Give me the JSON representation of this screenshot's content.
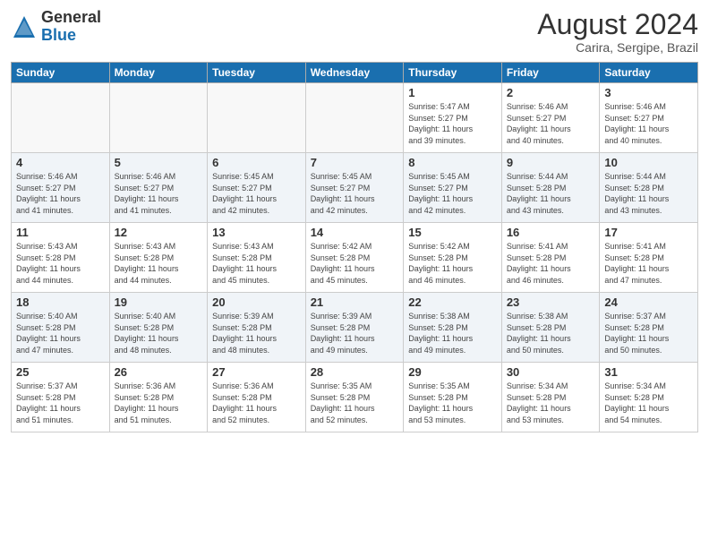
{
  "header": {
    "logo_general": "General",
    "logo_blue": "Blue",
    "month_year": "August 2024",
    "location": "Carira, Sergipe, Brazil"
  },
  "days_of_week": [
    "Sunday",
    "Monday",
    "Tuesday",
    "Wednesday",
    "Thursday",
    "Friday",
    "Saturday"
  ],
  "weeks": [
    [
      {
        "day": "",
        "sunrise": "",
        "sunset": "",
        "daylight": ""
      },
      {
        "day": "",
        "sunrise": "",
        "sunset": "",
        "daylight": ""
      },
      {
        "day": "",
        "sunrise": "",
        "sunset": "",
        "daylight": ""
      },
      {
        "day": "",
        "sunrise": "",
        "sunset": "",
        "daylight": ""
      },
      {
        "day": "1",
        "sunrise": "5:47 AM",
        "sunset": "5:27 PM",
        "daylight": "11 hours and 39 minutes."
      },
      {
        "day": "2",
        "sunrise": "5:46 AM",
        "sunset": "5:27 PM",
        "daylight": "11 hours and 40 minutes."
      },
      {
        "day": "3",
        "sunrise": "5:46 AM",
        "sunset": "5:27 PM",
        "daylight": "11 hours and 40 minutes."
      }
    ],
    [
      {
        "day": "4",
        "sunrise": "5:46 AM",
        "sunset": "5:27 PM",
        "daylight": "11 hours and 41 minutes."
      },
      {
        "day": "5",
        "sunrise": "5:46 AM",
        "sunset": "5:27 PM",
        "daylight": "11 hours and 41 minutes."
      },
      {
        "day": "6",
        "sunrise": "5:45 AM",
        "sunset": "5:27 PM",
        "daylight": "11 hours and 42 minutes."
      },
      {
        "day": "7",
        "sunrise": "5:45 AM",
        "sunset": "5:27 PM",
        "daylight": "11 hours and 42 minutes."
      },
      {
        "day": "8",
        "sunrise": "5:45 AM",
        "sunset": "5:27 PM",
        "daylight": "11 hours and 42 minutes."
      },
      {
        "day": "9",
        "sunrise": "5:44 AM",
        "sunset": "5:28 PM",
        "daylight": "11 hours and 43 minutes."
      },
      {
        "day": "10",
        "sunrise": "5:44 AM",
        "sunset": "5:28 PM",
        "daylight": "11 hours and 43 minutes."
      }
    ],
    [
      {
        "day": "11",
        "sunrise": "5:43 AM",
        "sunset": "5:28 PM",
        "daylight": "11 hours and 44 minutes."
      },
      {
        "day": "12",
        "sunrise": "5:43 AM",
        "sunset": "5:28 PM",
        "daylight": "11 hours and 44 minutes."
      },
      {
        "day": "13",
        "sunrise": "5:43 AM",
        "sunset": "5:28 PM",
        "daylight": "11 hours and 45 minutes."
      },
      {
        "day": "14",
        "sunrise": "5:42 AM",
        "sunset": "5:28 PM",
        "daylight": "11 hours and 45 minutes."
      },
      {
        "day": "15",
        "sunrise": "5:42 AM",
        "sunset": "5:28 PM",
        "daylight": "11 hours and 46 minutes."
      },
      {
        "day": "16",
        "sunrise": "5:41 AM",
        "sunset": "5:28 PM",
        "daylight": "11 hours and 46 minutes."
      },
      {
        "day": "17",
        "sunrise": "5:41 AM",
        "sunset": "5:28 PM",
        "daylight": "11 hours and 47 minutes."
      }
    ],
    [
      {
        "day": "18",
        "sunrise": "5:40 AM",
        "sunset": "5:28 PM",
        "daylight": "11 hours and 47 minutes."
      },
      {
        "day": "19",
        "sunrise": "5:40 AM",
        "sunset": "5:28 PM",
        "daylight": "11 hours and 48 minutes."
      },
      {
        "day": "20",
        "sunrise": "5:39 AM",
        "sunset": "5:28 PM",
        "daylight": "11 hours and 48 minutes."
      },
      {
        "day": "21",
        "sunrise": "5:39 AM",
        "sunset": "5:28 PM",
        "daylight": "11 hours and 49 minutes."
      },
      {
        "day": "22",
        "sunrise": "5:38 AM",
        "sunset": "5:28 PM",
        "daylight": "11 hours and 49 minutes."
      },
      {
        "day": "23",
        "sunrise": "5:38 AM",
        "sunset": "5:28 PM",
        "daylight": "11 hours and 50 minutes."
      },
      {
        "day": "24",
        "sunrise": "5:37 AM",
        "sunset": "5:28 PM",
        "daylight": "11 hours and 50 minutes."
      }
    ],
    [
      {
        "day": "25",
        "sunrise": "5:37 AM",
        "sunset": "5:28 PM",
        "daylight": "11 hours and 51 minutes."
      },
      {
        "day": "26",
        "sunrise": "5:36 AM",
        "sunset": "5:28 PM",
        "daylight": "11 hours and 51 minutes."
      },
      {
        "day": "27",
        "sunrise": "5:36 AM",
        "sunset": "5:28 PM",
        "daylight": "11 hours and 52 minutes."
      },
      {
        "day": "28",
        "sunrise": "5:35 AM",
        "sunset": "5:28 PM",
        "daylight": "11 hours and 52 minutes."
      },
      {
        "day": "29",
        "sunrise": "5:35 AM",
        "sunset": "5:28 PM",
        "daylight": "11 hours and 53 minutes."
      },
      {
        "day": "30",
        "sunrise": "5:34 AM",
        "sunset": "5:28 PM",
        "daylight": "11 hours and 53 minutes."
      },
      {
        "day": "31",
        "sunrise": "5:34 AM",
        "sunset": "5:28 PM",
        "daylight": "11 hours and 54 minutes."
      }
    ]
  ],
  "labels": {
    "sunrise": "Sunrise:",
    "sunset": "Sunset:",
    "daylight": "Daylight hours"
  }
}
